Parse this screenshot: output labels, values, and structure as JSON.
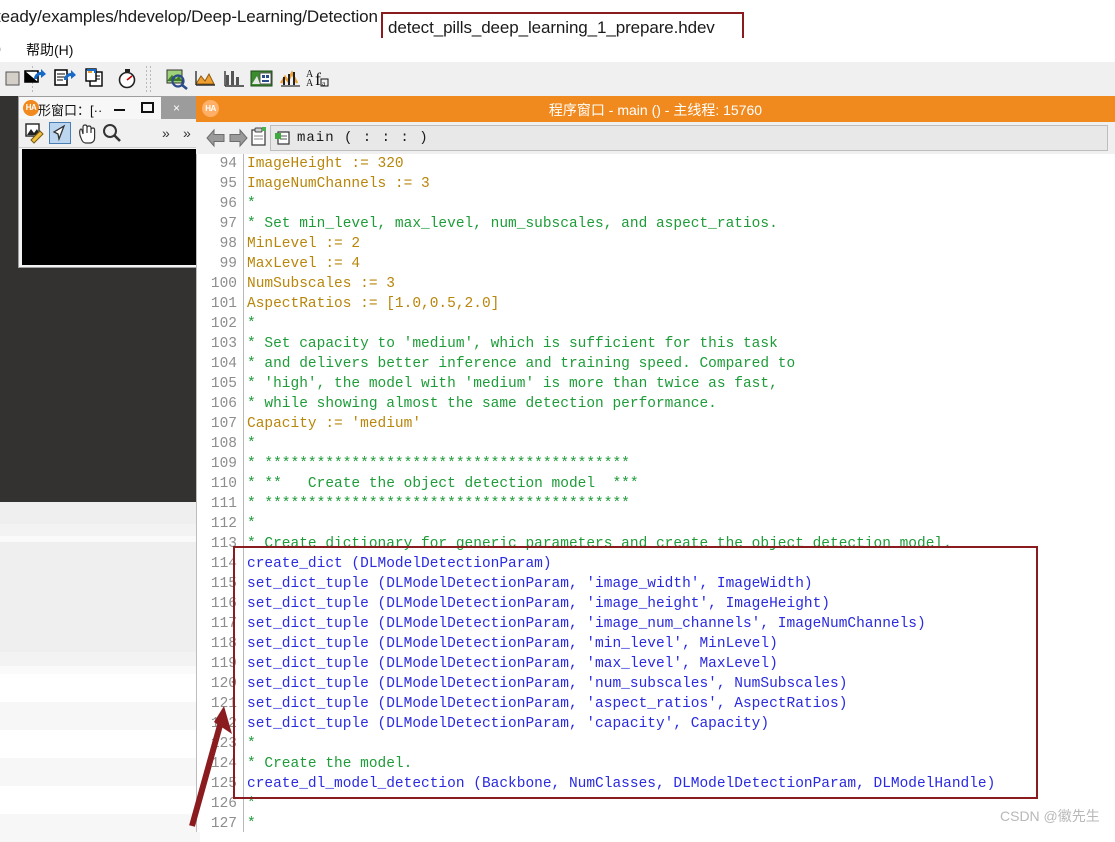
{
  "pathbar": {
    "prefix": "teady/examples/hdevelop/Deep-Learning/Detection",
    "filename": "detect_pills_deep_learning_1_prepare.hdev",
    "highlight_color": "#8a1c20"
  },
  "menubar": {
    "tail_item": "）",
    "help_item": "帮助(H)"
  },
  "toolbar": {
    "icons": [
      "stop-icon",
      "step-over-icon",
      "step-into-icon",
      "step-out-icon",
      "stopwatch-icon",
      "inspect-icon",
      "gray-histogram-icon",
      "histogram-icon",
      "feature-window-icon",
      "profile-icon",
      "font-icon"
    ]
  },
  "graphics_window": {
    "badge": "HA",
    "title": "形窗口：[··",
    "minimize_label": "minimize-button",
    "maximize_label": "maximize-button",
    "close_label": "×",
    "tools": [
      "draw-icon",
      "arrow-select-icon",
      "pan-hand-icon",
      "zoom-magnifier-icon",
      "overflow-chevrons-icon"
    ],
    "canvas_color": "#000000"
  },
  "program_window": {
    "badge": "HA",
    "title": "程序窗口 - main () - 主线程: 15760",
    "accent_color": "#f08a1e",
    "nav": {
      "back": "back-arrow-icon",
      "forward": "forward-arrow-icon",
      "clipboard": "clipboard-icon",
      "procedure_icon": "procedure-icon",
      "procedure_label": "main ( : : : )"
    }
  },
  "code": {
    "first_line_number": 94,
    "lines": [
      {
        "n": 94,
        "t": "ImageHeight := 320",
        "k": "assign"
      },
      {
        "n": 95,
        "t": "ImageNumChannels := 3",
        "k": "assign"
      },
      {
        "n": 96,
        "t": "*",
        "k": "comment"
      },
      {
        "n": 97,
        "t": "* Set min_level, max_level, num_subscales, and aspect_ratios.",
        "k": "comment"
      },
      {
        "n": 98,
        "t": "MinLevel := 2",
        "k": "assign"
      },
      {
        "n": 99,
        "t": "MaxLevel := 4",
        "k": "assign"
      },
      {
        "n": 100,
        "t": "NumSubscales := 3",
        "k": "assign"
      },
      {
        "n": 101,
        "t": "AspectRatios := [1.0,0.5,2.0]",
        "k": "assign"
      },
      {
        "n": 102,
        "t": "*",
        "k": "comment"
      },
      {
        "n": 103,
        "t": "* Set capacity to 'medium', which is sufficient for this task",
        "k": "comment"
      },
      {
        "n": 104,
        "t": "* and delivers better inference and training speed. Compared to",
        "k": "comment"
      },
      {
        "n": 105,
        "t": "* 'high', the model with 'medium' is more than twice as fast,",
        "k": "comment"
      },
      {
        "n": 106,
        "t": "* while showing almost the same detection performance.",
        "k": "comment"
      },
      {
        "n": 107,
        "t": "Capacity := 'medium'",
        "k": "assign"
      },
      {
        "n": 108,
        "t": "*",
        "k": "comment"
      },
      {
        "n": 109,
        "t": "* ******************************************",
        "k": "comment"
      },
      {
        "n": 110,
        "t": "* **   Create the object detection model  ***",
        "k": "comment"
      },
      {
        "n": 111,
        "t": "* ******************************************",
        "k": "comment"
      },
      {
        "n": 112,
        "t": "*",
        "k": "comment"
      },
      {
        "n": 113,
        "t": "* Create dictionary for generic parameters and create the object detection model.",
        "k": "comment"
      },
      {
        "n": 114,
        "t": "create_dict (DLModelDetectionParam)",
        "k": "call"
      },
      {
        "n": 115,
        "t": "set_dict_tuple (DLModelDetectionParam, 'image_width', ImageWidth)",
        "k": "call"
      },
      {
        "n": 116,
        "t": "set_dict_tuple (DLModelDetectionParam, 'image_height', ImageHeight)",
        "k": "call"
      },
      {
        "n": 117,
        "t": "set_dict_tuple (DLModelDetectionParam, 'image_num_channels', ImageNumChannels)",
        "k": "call"
      },
      {
        "n": 118,
        "t": "set_dict_tuple (DLModelDetectionParam, 'min_level', MinLevel)",
        "k": "call"
      },
      {
        "n": 119,
        "t": "set_dict_tuple (DLModelDetectionParam, 'max_level', MaxLevel)",
        "k": "call"
      },
      {
        "n": 120,
        "t": "set_dict_tuple (DLModelDetectionParam, 'num_subscales', NumSubscales)",
        "k": "call"
      },
      {
        "n": 121,
        "t": "set_dict_tuple (DLModelDetectionParam, 'aspect_ratios', AspectRatios)",
        "k": "call"
      },
      {
        "n": 122,
        "t": "set_dict_tuple (DLModelDetectionParam, 'capacity', Capacity)",
        "k": "call"
      },
      {
        "n": 123,
        "t": "*",
        "k": "comment"
      },
      {
        "n": 124,
        "t": "* Create the model.",
        "k": "comment"
      },
      {
        "n": 125,
        "t": "create_dl_model_detection (Backbone, NumClasses, DLModelDetectionParam, DLModelHandle)",
        "k": "call"
      },
      {
        "n": 126,
        "t": "*",
        "k": "comment"
      },
      {
        "n": 127,
        "t": "*",
        "k": "comment"
      }
    ],
    "colors": {
      "comment": "#1f9c3a",
      "assignment": "#b8860b",
      "call": "#2a2ae0",
      "line_number": "#8d8d8d"
    }
  },
  "annotations": {
    "highlight_box_label": "code-highlight-box",
    "arrow_label": "red-pointer-arrow",
    "color": "#8a1c20"
  },
  "watermark": {
    "text": "CSDN @徽先生"
  }
}
